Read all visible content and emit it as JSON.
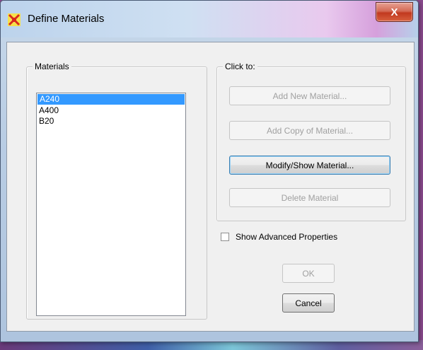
{
  "window": {
    "title": "Define Materials",
    "close_label": "X",
    "app_icon": "app-icon"
  },
  "materials_group": {
    "legend": "Materials",
    "items": [
      {
        "label": "A240",
        "selected": true
      },
      {
        "label": "A400",
        "selected": false
      },
      {
        "label": "B20",
        "selected": false
      }
    ]
  },
  "click_to_group": {
    "legend": "Click to:",
    "buttons": [
      {
        "label": "Add New Material...",
        "enabled": false
      },
      {
        "label": "Add Copy of Material...",
        "enabled": false
      },
      {
        "label": "Modify/Show Material...",
        "enabled": true
      },
      {
        "label": "Delete Material",
        "enabled": false
      }
    ]
  },
  "advanced": {
    "label": "Show Advanced Properties",
    "checked": false
  },
  "footer": {
    "ok_label": "OK",
    "cancel_label": "Cancel"
  },
  "colors": {
    "selection": "#3399ff",
    "disabled_text": "#a0a0a0"
  }
}
